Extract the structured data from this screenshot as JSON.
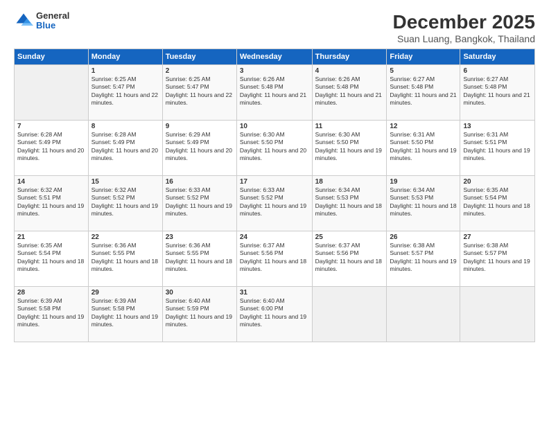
{
  "header": {
    "logo_general": "General",
    "logo_blue": "Blue",
    "title": "December 2025",
    "subtitle": "Suan Luang, Bangkok, Thailand"
  },
  "weekdays": [
    "Sunday",
    "Monday",
    "Tuesday",
    "Wednesday",
    "Thursday",
    "Friday",
    "Saturday"
  ],
  "weeks": [
    [
      {
        "day": "",
        "sunrise": "",
        "sunset": "",
        "daylight": ""
      },
      {
        "day": "1",
        "sunrise": "Sunrise: 6:25 AM",
        "sunset": "Sunset: 5:47 PM",
        "daylight": "Daylight: 11 hours and 22 minutes."
      },
      {
        "day": "2",
        "sunrise": "Sunrise: 6:25 AM",
        "sunset": "Sunset: 5:47 PM",
        "daylight": "Daylight: 11 hours and 22 minutes."
      },
      {
        "day": "3",
        "sunrise": "Sunrise: 6:26 AM",
        "sunset": "Sunset: 5:48 PM",
        "daylight": "Daylight: 11 hours and 21 minutes."
      },
      {
        "day": "4",
        "sunrise": "Sunrise: 6:26 AM",
        "sunset": "Sunset: 5:48 PM",
        "daylight": "Daylight: 11 hours and 21 minutes."
      },
      {
        "day": "5",
        "sunrise": "Sunrise: 6:27 AM",
        "sunset": "Sunset: 5:48 PM",
        "daylight": "Daylight: 11 hours and 21 minutes."
      },
      {
        "day": "6",
        "sunrise": "Sunrise: 6:27 AM",
        "sunset": "Sunset: 5:48 PM",
        "daylight": "Daylight: 11 hours and 21 minutes."
      }
    ],
    [
      {
        "day": "7",
        "sunrise": "Sunrise: 6:28 AM",
        "sunset": "Sunset: 5:49 PM",
        "daylight": "Daylight: 11 hours and 20 minutes."
      },
      {
        "day": "8",
        "sunrise": "Sunrise: 6:28 AM",
        "sunset": "Sunset: 5:49 PM",
        "daylight": "Daylight: 11 hours and 20 minutes."
      },
      {
        "day": "9",
        "sunrise": "Sunrise: 6:29 AM",
        "sunset": "Sunset: 5:49 PM",
        "daylight": "Daylight: 11 hours and 20 minutes."
      },
      {
        "day": "10",
        "sunrise": "Sunrise: 6:30 AM",
        "sunset": "Sunset: 5:50 PM",
        "daylight": "Daylight: 11 hours and 20 minutes."
      },
      {
        "day": "11",
        "sunrise": "Sunrise: 6:30 AM",
        "sunset": "Sunset: 5:50 PM",
        "daylight": "Daylight: 11 hours and 19 minutes."
      },
      {
        "day": "12",
        "sunrise": "Sunrise: 6:31 AM",
        "sunset": "Sunset: 5:50 PM",
        "daylight": "Daylight: 11 hours and 19 minutes."
      },
      {
        "day": "13",
        "sunrise": "Sunrise: 6:31 AM",
        "sunset": "Sunset: 5:51 PM",
        "daylight": "Daylight: 11 hours and 19 minutes."
      }
    ],
    [
      {
        "day": "14",
        "sunrise": "Sunrise: 6:32 AM",
        "sunset": "Sunset: 5:51 PM",
        "daylight": "Daylight: 11 hours and 19 minutes."
      },
      {
        "day": "15",
        "sunrise": "Sunrise: 6:32 AM",
        "sunset": "Sunset: 5:52 PM",
        "daylight": "Daylight: 11 hours and 19 minutes."
      },
      {
        "day": "16",
        "sunrise": "Sunrise: 6:33 AM",
        "sunset": "Sunset: 5:52 PM",
        "daylight": "Daylight: 11 hours and 19 minutes."
      },
      {
        "day": "17",
        "sunrise": "Sunrise: 6:33 AM",
        "sunset": "Sunset: 5:52 PM",
        "daylight": "Daylight: 11 hours and 19 minutes."
      },
      {
        "day": "18",
        "sunrise": "Sunrise: 6:34 AM",
        "sunset": "Sunset: 5:53 PM",
        "daylight": "Daylight: 11 hours and 18 minutes."
      },
      {
        "day": "19",
        "sunrise": "Sunrise: 6:34 AM",
        "sunset": "Sunset: 5:53 PM",
        "daylight": "Daylight: 11 hours and 18 minutes."
      },
      {
        "day": "20",
        "sunrise": "Sunrise: 6:35 AM",
        "sunset": "Sunset: 5:54 PM",
        "daylight": "Daylight: 11 hours and 18 minutes."
      }
    ],
    [
      {
        "day": "21",
        "sunrise": "Sunrise: 6:35 AM",
        "sunset": "Sunset: 5:54 PM",
        "daylight": "Daylight: 11 hours and 18 minutes."
      },
      {
        "day": "22",
        "sunrise": "Sunrise: 6:36 AM",
        "sunset": "Sunset: 5:55 PM",
        "daylight": "Daylight: 11 hours and 18 minutes."
      },
      {
        "day": "23",
        "sunrise": "Sunrise: 6:36 AM",
        "sunset": "Sunset: 5:55 PM",
        "daylight": "Daylight: 11 hours and 18 minutes."
      },
      {
        "day": "24",
        "sunrise": "Sunrise: 6:37 AM",
        "sunset": "Sunset: 5:56 PM",
        "daylight": "Daylight: 11 hours and 18 minutes."
      },
      {
        "day": "25",
        "sunrise": "Sunrise: 6:37 AM",
        "sunset": "Sunset: 5:56 PM",
        "daylight": "Daylight: 11 hours and 18 minutes."
      },
      {
        "day": "26",
        "sunrise": "Sunrise: 6:38 AM",
        "sunset": "Sunset: 5:57 PM",
        "daylight": "Daylight: 11 hours and 19 minutes."
      },
      {
        "day": "27",
        "sunrise": "Sunrise: 6:38 AM",
        "sunset": "Sunset: 5:57 PM",
        "daylight": "Daylight: 11 hours and 19 minutes."
      }
    ],
    [
      {
        "day": "28",
        "sunrise": "Sunrise: 6:39 AM",
        "sunset": "Sunset: 5:58 PM",
        "daylight": "Daylight: 11 hours and 19 minutes."
      },
      {
        "day": "29",
        "sunrise": "Sunrise: 6:39 AM",
        "sunset": "Sunset: 5:58 PM",
        "daylight": "Daylight: 11 hours and 19 minutes."
      },
      {
        "day": "30",
        "sunrise": "Sunrise: 6:40 AM",
        "sunset": "Sunset: 5:59 PM",
        "daylight": "Daylight: 11 hours and 19 minutes."
      },
      {
        "day": "31",
        "sunrise": "Sunrise: 6:40 AM",
        "sunset": "Sunset: 6:00 PM",
        "daylight": "Daylight: 11 hours and 19 minutes."
      },
      {
        "day": "",
        "sunrise": "",
        "sunset": "",
        "daylight": ""
      },
      {
        "day": "",
        "sunrise": "",
        "sunset": "",
        "daylight": ""
      },
      {
        "day": "",
        "sunrise": "",
        "sunset": "",
        "daylight": ""
      }
    ]
  ]
}
